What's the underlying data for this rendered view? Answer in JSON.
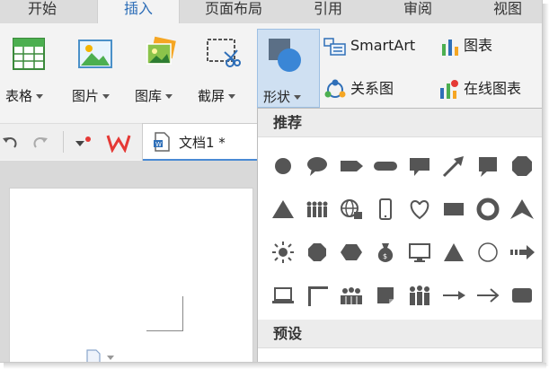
{
  "tabs": [
    "开始",
    "插入",
    "页面布局",
    "引用",
    "审阅",
    "视图"
  ],
  "active_tab": "插入",
  "ribbon": {
    "table_label": "表格",
    "picture_label": "图片",
    "gallery_label": "图库",
    "screenshot_label": "截屏",
    "shapes_label": "形状",
    "smartart_label": "SmartArt",
    "chart_label": "图表",
    "relation_label": "关系图",
    "online_chart_label": "在线图表"
  },
  "document": {
    "tab_label": "文档1 *"
  },
  "shapes_menu": {
    "recommended_header": "推荐",
    "preset_header": "预设"
  },
  "colors": {
    "accent": "#2f6fb8",
    "shape_gray": "#555555",
    "selected_bg": "#cfe0f2"
  }
}
